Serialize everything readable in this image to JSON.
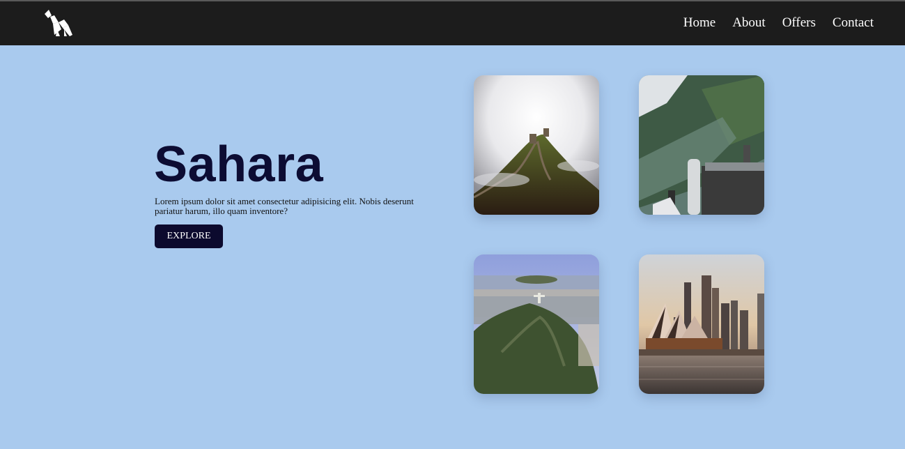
{
  "nav": {
    "logo_icon": "camel-icon",
    "links": [
      "Home",
      "About",
      "Offers",
      "Contact"
    ]
  },
  "hero": {
    "title": "Sahara",
    "description": "Lorem ipsum dolor sit amet consectetur adipisicing elit. Nobis deserunt pariatur harum, illo quam inventore?",
    "button_label": "EXPLORE"
  },
  "gallery": {
    "images": [
      "great-wall-image",
      "mountain-valley-image",
      "christ-the-redeemer-image",
      "sydney-opera-house-image"
    ]
  },
  "colors": {
    "background": "#a9caee",
    "navbar": "#1c1c1c",
    "title": "#0c0c33",
    "button": "#0c0a2e"
  }
}
